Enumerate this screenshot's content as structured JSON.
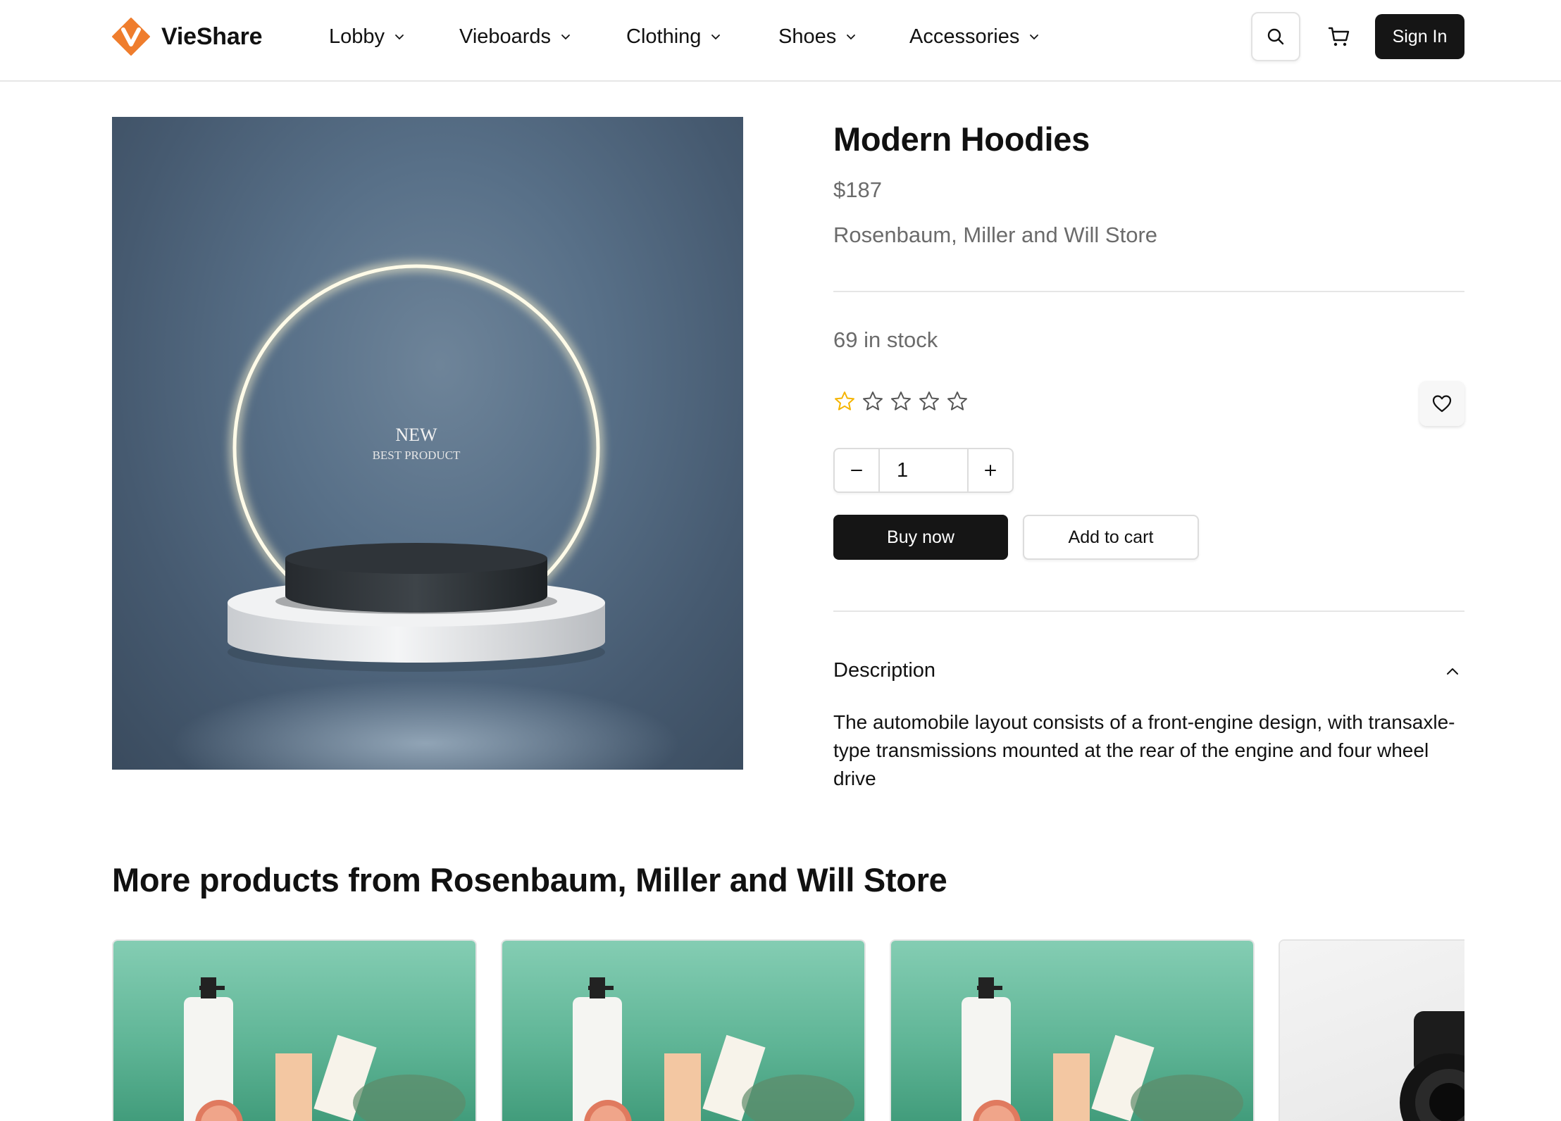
{
  "header": {
    "brand": "VieShare",
    "brand_color": "#ef7d2d",
    "nav": [
      {
        "label": "Lobby",
        "icon": "chevron-down-icon"
      },
      {
        "label": "Vieboards",
        "icon": "chevron-down-icon"
      },
      {
        "label": "Clothing",
        "icon": "chevron-down-icon"
      },
      {
        "label": "Shoes",
        "icon": "chevron-down-icon"
      },
      {
        "label": "Accessories",
        "icon": "chevron-down-icon"
      }
    ],
    "search_icon": "search-icon",
    "cart_icon": "cart-icon",
    "sign_in": "Sign In"
  },
  "product": {
    "image": {
      "headline": "NEW",
      "subline": "BEST PRODUCT"
    },
    "title": "Modern Hoodies",
    "price": "$187",
    "store": "Rosenbaum, Miller and Will Store",
    "stock": "69 in stock",
    "rating": {
      "value": 1,
      "max": 5,
      "filled_color": "#f5b400"
    },
    "wishlist_icon": "heart-icon",
    "quantity": {
      "value": "1",
      "decrement_icon": "minus-icon",
      "increment_icon": "plus-icon"
    },
    "buy_now": "Buy now",
    "add_to_cart": "Add to cart",
    "description": {
      "heading": "Description",
      "expanded": true,
      "toggle_icon": "chevron-up-icon",
      "text": "The automobile layout consists of a front-engine design, with transaxle-type transmissions mounted at the rear of the engine and four wheel drive"
    }
  },
  "more": {
    "title": "More products from Rosenbaum, Miller and Will Store",
    "cards": [
      {
        "image": "skincare-products-image"
      },
      {
        "image": "skincare-products-image"
      },
      {
        "image": "skincare-products-image"
      },
      {
        "image": "camera-image"
      }
    ]
  }
}
